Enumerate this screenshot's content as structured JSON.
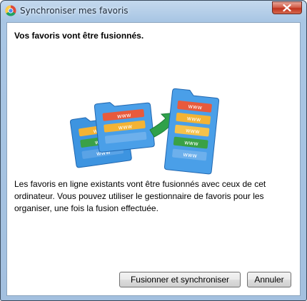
{
  "window": {
    "title": "Synchroniser mes favoris"
  },
  "content": {
    "heading": "Vos favoris vont être fusionnés.",
    "message": "Les favoris en ligne existants vont être fusionnés avec ceux de cet ordinateur. Vous pouvez utiliser le gestionnaire de favoris pour les organiser, une fois la fusion effectuée.",
    "bookmark_label": "www"
  },
  "buttons": {
    "merge": "Fusionner et synchroniser",
    "cancel": "Annuler"
  }
}
